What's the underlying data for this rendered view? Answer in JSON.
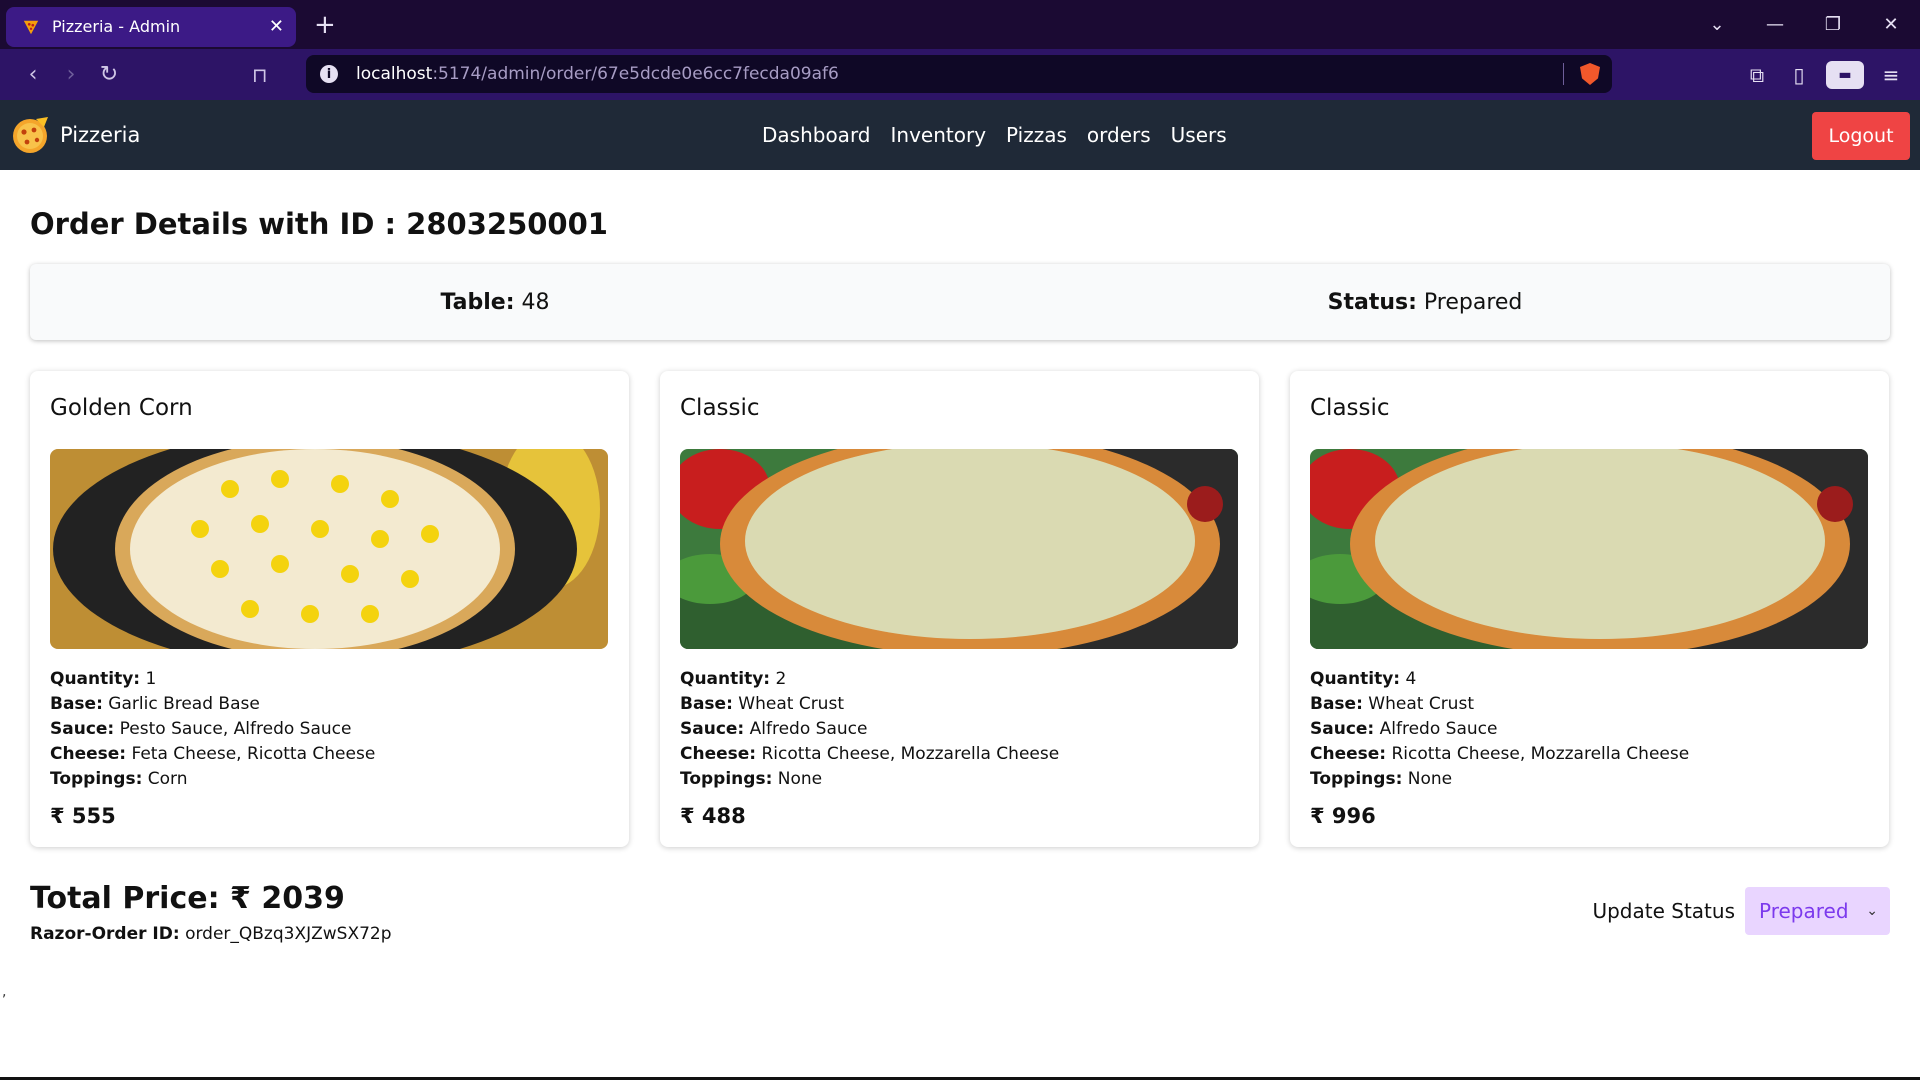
{
  "browser": {
    "tab_title": "Pizzeria - Admin",
    "url_host": "localhost",
    "url_path": ":5174/admin/order/67e5dcde0e6cc7fecda09af6"
  },
  "nav": {
    "brand": "Pizzeria",
    "links": [
      "Dashboard",
      "Inventory",
      "Pizzas",
      "orders",
      "Users"
    ],
    "logout": "Logout"
  },
  "order": {
    "title": "Order Details with ID : 2803250001",
    "table_label": "Table:",
    "table_value": "48",
    "status_label": "Status:",
    "status_value": "Prepared"
  },
  "labels": {
    "quantity": "Quantity:",
    "base": "Base:",
    "sauce": "Sauce:",
    "cheese": "Cheese:",
    "toppings": "Toppings:"
  },
  "items": [
    {
      "name": "Golden Corn",
      "quantity": "1",
      "base": "Garlic Bread Base",
      "sauce": "Pesto Sauce, Alfredo Sauce",
      "cheese": "Feta Cheese, Ricotta Cheese",
      "toppings": "Corn",
      "price": "₹ 555"
    },
    {
      "name": "Classic",
      "quantity": "2",
      "base": "Wheat Crust",
      "sauce": "Alfredo Sauce",
      "cheese": "Ricotta Cheese, Mozzarella Cheese",
      "toppings": "None",
      "price": "₹ 488"
    },
    {
      "name": "Classic",
      "quantity": "4",
      "base": "Wheat Crust",
      "sauce": "Alfredo Sauce",
      "cheese": "Ricotta Cheese, Mozzarella Cheese",
      "toppings": "None",
      "price": "₹ 996"
    }
  ],
  "footer": {
    "total": "Total Price: ₹ 2039",
    "razor_label": "Razor-Order ID:",
    "razor_value": "order_QBzq3XJZwSX72p",
    "update_label": "Update Status",
    "status_selected": "Prepared"
  },
  "stray_mark": ","
}
